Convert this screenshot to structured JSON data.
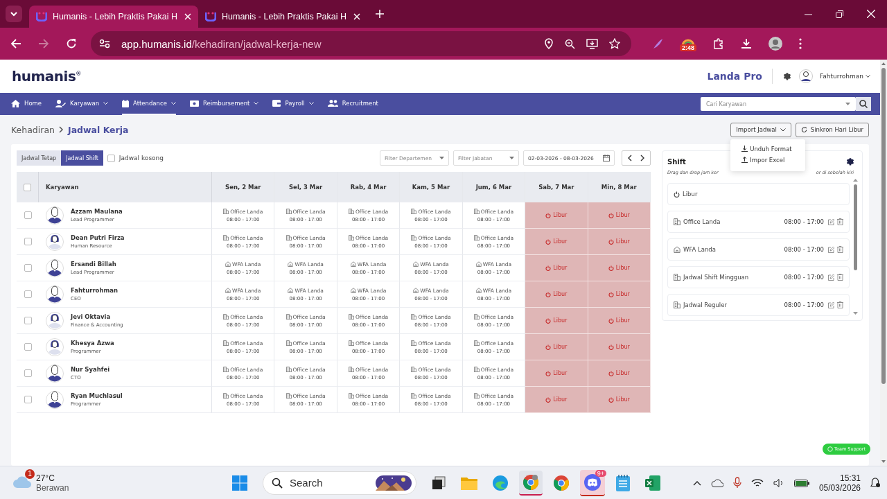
{
  "browser": {
    "tabs": [
      {
        "title": "Humanis - Lebih Praktis Pakai H",
        "selected": true
      },
      {
        "title": "Humanis - Lebih Praktis Pakai H",
        "selected": false
      }
    ],
    "url_host": "app.humanis.id",
    "url_path": "/kehadiran/jadwal-kerja-new",
    "extension_badge": "2:48"
  },
  "header": {
    "logo": "humanis$^{®}$",
    "company": "Landa Pro",
    "user": "Fahturrohman"
  },
  "nav": [
    {
      "label": "Home",
      "kind": "home",
      "dropdown": false,
      "selected": false
    },
    {
      "label": "Karyawan",
      "kind": "user",
      "dropdown": true,
      "selected": false
    },
    {
      "label": "Attendance",
      "kind": "calendar",
      "dropdown": true,
      "selected": true
    },
    {
      "label": "Reimbursement",
      "kind": "money",
      "dropdown": true,
      "selected": false
    },
    {
      "label": "Payroll",
      "kind": "wallet",
      "dropdown": true,
      "selected": false
    },
    {
      "label": "Recruitment",
      "kind": "users",
      "dropdown": false,
      "selected": false
    }
  ],
  "search": {
    "placeholder": "Cari Karyawan"
  },
  "breadcrumb": [
    "Kehadiran",
    "Jadwal Kerja"
  ],
  "actions": {
    "import": "Import Jadwal",
    "sync": "Sinkron Hari Libur"
  },
  "import_menu": [
    {
      "label": "Unduh Format",
      "kind": "download"
    },
    {
      "label": "Impor Excel",
      "kind": "upload"
    }
  ],
  "mode_tabs": [
    {
      "label": "Jadwal Tetap",
      "selected": false
    },
    {
      "label": "Jadwal Shift",
      "selected": true
    }
  ],
  "empty_filter": {
    "label": "Jadwal kosong",
    "checked": false
  },
  "filters": {
    "department": "Filter Departemen",
    "position": "Filter Jabatan",
    "date_range": "02-03-2026 - 08-03-2026"
  },
  "table": {
    "all_checked": false,
    "employee_column": "Karyawan",
    "day_columns": [
      "Sen, 2 Mar",
      "Sel, 3 Mar",
      "Rab, 4 Mar",
      "Kam, 5 Mar",
      "Jum, 6 Mar",
      "Sab, 7 Mar",
      "Min, 8 Mar"
    ],
    "rows": [
      {
        "name": "Azzam Maulana",
        "role": "Lead Programmer",
        "kind": "male",
        "checked": false,
        "cells": [
          {
            "kind": "office",
            "label": "Office Landa",
            "time": "08:00 - 17:00"
          },
          {
            "kind": "office",
            "label": "Office Landa",
            "time": "08:00 - 17:00"
          },
          {
            "kind": "office",
            "label": "Office Landa",
            "time": "08:00 - 17:00"
          },
          {
            "kind": "office",
            "label": "Office Landa",
            "time": "08:00 - 17:00"
          },
          {
            "kind": "office",
            "label": "Office Landa",
            "time": "08:00 - 17:00"
          },
          {
            "kind": "off",
            "label": "Libur"
          },
          {
            "kind": "off",
            "label": "Libur"
          }
        ]
      },
      {
        "name": "Dean Putri Firza",
        "role": "Human Resource",
        "kind": "female",
        "checked": false,
        "cells": [
          {
            "kind": "office",
            "label": "Office Landa",
            "time": "08:00 - 17:00"
          },
          {
            "kind": "office",
            "label": "Office Landa",
            "time": "08:00 - 17:00"
          },
          {
            "kind": "office",
            "label": "Office Landa",
            "time": "08:00 - 17:00"
          },
          {
            "kind": "office",
            "label": "Office Landa",
            "time": "08:00 - 17:00"
          },
          {
            "kind": "office",
            "label": "Office Landa",
            "time": "08:00 - 17:00"
          },
          {
            "kind": "off",
            "label": "Libur"
          },
          {
            "kind": "off",
            "label": "Libur"
          }
        ]
      },
      {
        "name": "Ersandi Billah",
        "role": "Lead Programmer",
        "kind": "male",
        "checked": false,
        "cells": [
          {
            "kind": "wfa",
            "label": "WFA Landa",
            "time": "08:00 - 17:00"
          },
          {
            "kind": "wfa",
            "label": "WFA Landa",
            "time": "08:00 - 17:00"
          },
          {
            "kind": "wfa",
            "label": "WFA Landa",
            "time": "08:00 - 17:00"
          },
          {
            "kind": "wfa",
            "label": "WFA Landa",
            "time": "08:00 - 17:00"
          },
          {
            "kind": "wfa",
            "label": "WFA Landa",
            "time": "08:00 - 17:00"
          },
          {
            "kind": "off",
            "label": "Libur"
          },
          {
            "kind": "off",
            "label": "Libur"
          }
        ]
      },
      {
        "name": "Fahturrohman",
        "role": "CEO",
        "kind": "male",
        "checked": false,
        "cells": [
          {
            "kind": "wfa",
            "label": "WFA Landa",
            "time": "08:00 - 17:00"
          },
          {
            "kind": "wfa",
            "label": "WFA Landa",
            "time": "08:00 - 17:00"
          },
          {
            "kind": "wfa",
            "label": "WFA Landa",
            "time": "08:00 - 17:00"
          },
          {
            "kind": "wfa",
            "label": "WFA Landa",
            "time": "08:00 - 17:00"
          },
          {
            "kind": "wfa",
            "label": "WFA Landa",
            "time": "08:00 - 17:00"
          },
          {
            "kind": "off",
            "label": "Libur"
          },
          {
            "kind": "off",
            "label": "Libur"
          }
        ]
      },
      {
        "name": "Jevi Oktavia",
        "role": "Finance & Accounting",
        "kind": "female",
        "checked": false,
        "cells": [
          {
            "kind": "office",
            "label": "Office Landa",
            "time": "08:00 - 17:00"
          },
          {
            "kind": "office",
            "label": "Office Landa",
            "time": "08:00 - 17:00"
          },
          {
            "kind": "office",
            "label": "Office Landa",
            "time": "08:00 - 17:00"
          },
          {
            "kind": "office",
            "label": "Office Landa",
            "time": "08:00 - 17:00"
          },
          {
            "kind": "office",
            "label": "Office Landa",
            "time": "08:00 - 17:00"
          },
          {
            "kind": "off",
            "label": "Libur"
          },
          {
            "kind": "off",
            "label": "Libur"
          }
        ]
      },
      {
        "name": "Khesya Azwa",
        "role": "Programmer",
        "kind": "female",
        "checked": false,
        "cells": [
          {
            "kind": "office",
            "label": "Office Landa",
            "time": "08:00 - 17:00"
          },
          {
            "kind": "office",
            "label": "Office Landa",
            "time": "08:00 - 17:00"
          },
          {
            "kind": "office",
            "label": "Office Landa",
            "time": "08:00 - 17:00"
          },
          {
            "kind": "office",
            "label": "Office Landa",
            "time": "08:00 - 17:00"
          },
          {
            "kind": "office",
            "label": "Office Landa",
            "time": "08:00 - 17:00"
          },
          {
            "kind": "off",
            "label": "Libur"
          },
          {
            "kind": "off",
            "label": "Libur"
          }
        ]
      },
      {
        "name": "Nur Syahfei",
        "role": "CTO",
        "kind": "male",
        "checked": false,
        "cells": [
          {
            "kind": "office",
            "label": "Office Landa",
            "time": "08:00 - 17:00"
          },
          {
            "kind": "office",
            "label": "Office Landa",
            "time": "08:00 - 17:00"
          },
          {
            "kind": "office",
            "label": "Office Landa",
            "time": "08:00 - 17:00"
          },
          {
            "kind": "office",
            "label": "Office Landa",
            "time": "08:00 - 17:00"
          },
          {
            "kind": "office",
            "label": "Office Landa",
            "time": "08:00 - 17:00"
          },
          {
            "kind": "off",
            "label": "Libur"
          },
          {
            "kind": "off",
            "label": "Libur"
          }
        ]
      },
      {
        "name": "Ryan Muchlasul",
        "role": "Programmer",
        "kind": "male",
        "checked": false,
        "cells": [
          {
            "kind": "office",
            "label": "Office Landa",
            "time": "08:00 - 17:00"
          },
          {
            "kind": "office",
            "label": "Office Landa",
            "time": "08:00 - 17:00"
          },
          {
            "kind": "office",
            "label": "Office Landa",
            "time": "08:00 - 17:00"
          },
          {
            "kind": "office",
            "label": "Office Landa",
            "time": "08:00 - 17:00"
          },
          {
            "kind": "office",
            "label": "Office Landa",
            "time": "08:00 - 17:00"
          },
          {
            "kind": "off",
            "label": "Libur"
          },
          {
            "kind": "off",
            "label": "Libur"
          }
        ]
      }
    ]
  },
  "shift_panel": {
    "title": "Shift",
    "hint_start": "Drag dan drop jam ker",
    "hint_end": "or di sebelah kiri",
    "items": [
      {
        "kind": "off",
        "label": "Libur"
      },
      {
        "kind": "office",
        "label": "Office Landa",
        "time": "08:00 - 17:00"
      },
      {
        "kind": "wfa",
        "label": "WFA Landa",
        "time": "08:00 - 17:00"
      },
      {
        "kind": "office",
        "label": "Jadwal Shift Mingguan",
        "time": "08:00 - 17:00"
      },
      {
        "kind": "office",
        "label": "Jadwal Reguler",
        "time": "08:00 - 17:00"
      }
    ]
  },
  "support_button": "Team Support",
  "taskbar": {
    "temperature": "27°C",
    "condition": "Berawan",
    "weather_badge": "1",
    "search": "Search",
    "discord_badge": "9+",
    "time": "15:31",
    "date": "05/03/2026"
  }
}
